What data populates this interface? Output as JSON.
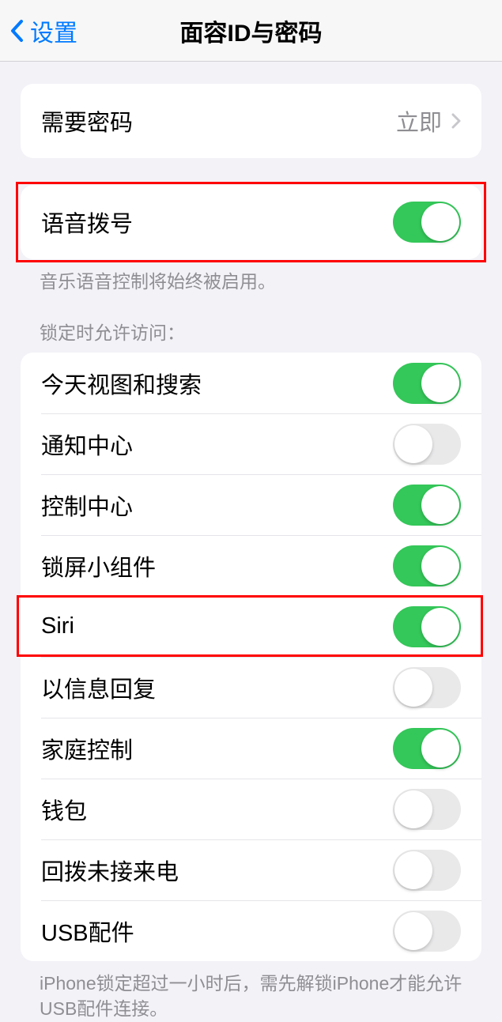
{
  "nav": {
    "back_label": "设置",
    "title": "面容ID与密码"
  },
  "require_passcode": {
    "label": "需要密码",
    "value": "立即"
  },
  "voice_dial": {
    "label": "语音拨号",
    "footnote": "音乐语音控制将始终被启用。",
    "enabled": true
  },
  "allow_access_header": "锁定时允许访问：",
  "allow_access": [
    {
      "label": "今天视图和搜索",
      "enabled": true
    },
    {
      "label": "通知中心",
      "enabled": false
    },
    {
      "label": "控制中心",
      "enabled": true
    },
    {
      "label": "锁屏小组件",
      "enabled": true
    },
    {
      "label": "Siri",
      "enabled": true
    },
    {
      "label": "以信息回复",
      "enabled": false
    },
    {
      "label": "家庭控制",
      "enabled": true
    },
    {
      "label": "钱包",
      "enabled": false
    },
    {
      "label": "回拨未接来电",
      "enabled": false
    },
    {
      "label": "USB配件",
      "enabled": false
    }
  ],
  "usb_footnote": "iPhone锁定超过一小时后，需先解锁iPhone才能允许USB配件连接。"
}
